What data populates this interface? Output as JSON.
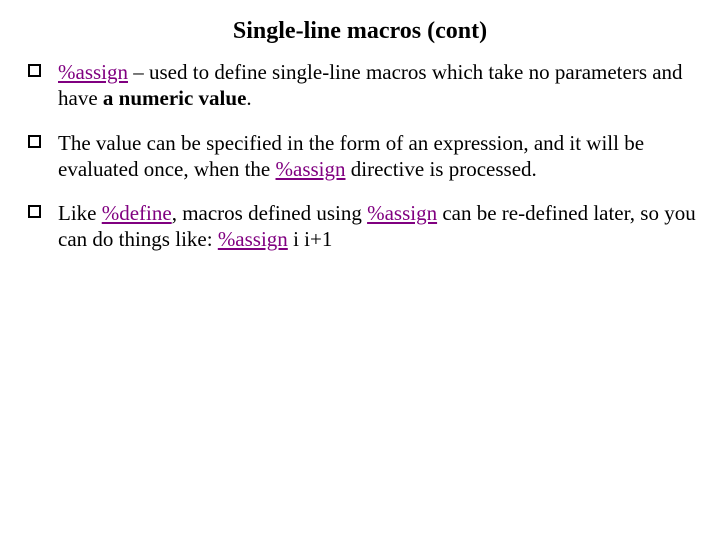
{
  "colors": {
    "keyword": "#800080"
  },
  "title": "Single-line macros (cont)",
  "bullets": [
    {
      "lead_space": " ",
      "kw1": "%assign",
      "t1": " – used to define single-line macros which take no parameters and have ",
      "bold1": "a numeric value",
      "t2": "."
    },
    {
      "t1": "The value can be specified in the form of an expression, and it will be evaluated once, when the ",
      "kw1": "%assign",
      "t2": " directive is processed."
    },
    {
      "lead_space": " ",
      "t1": "Like ",
      "kw1": "%define",
      "t2": ", macros defined using ",
      "kw2": "%assign",
      "t3": " can be re-defined later, so you can do things like: ",
      "kw3": "%assign",
      "t4": " i i+1"
    }
  ]
}
